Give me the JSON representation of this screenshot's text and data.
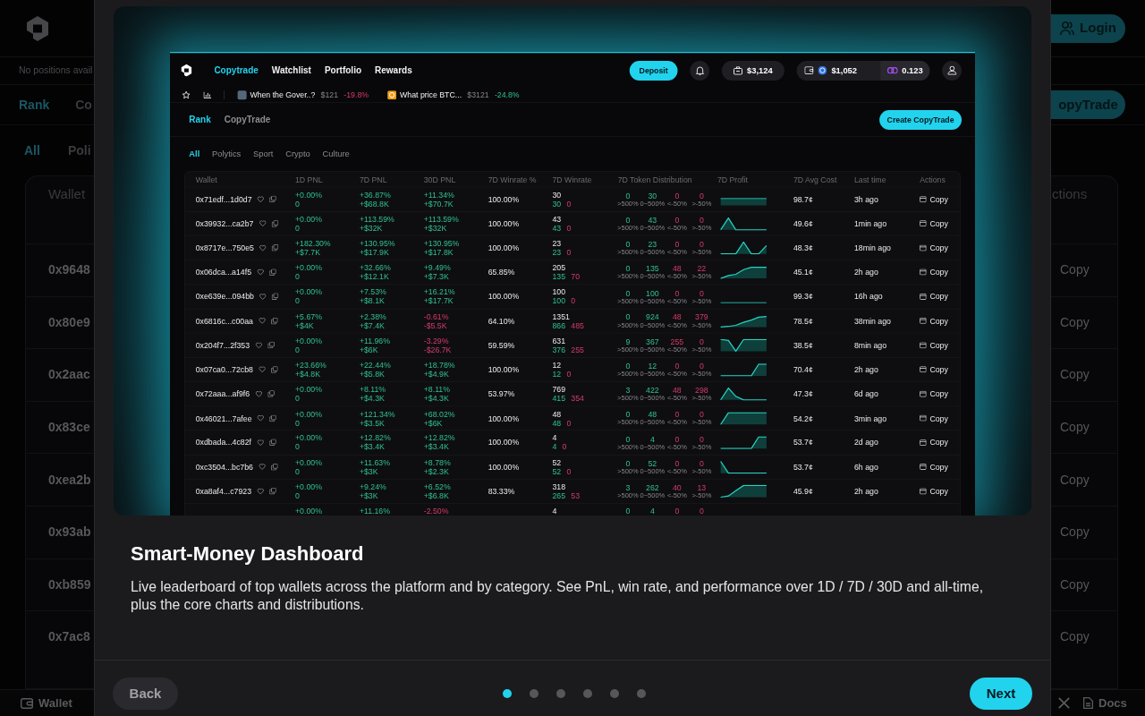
{
  "background_page": {
    "login_button": "Login",
    "notice": "No positions avail",
    "tabs": [
      {
        "label": "Rank",
        "selected": true
      },
      {
        "label": "Co",
        "selected": false
      }
    ],
    "create_button": "opyTrade",
    "filters": [
      {
        "label": "All",
        "selected": true
      },
      {
        "label": "Poli",
        "selected": false
      }
    ],
    "table": {
      "columns": [
        "Wallet",
        "ctions"
      ],
      "rows": [
        {
          "wallet": "0x9648",
          "action": "Copy"
        },
        {
          "wallet": "0x80e9",
          "action": "Copy"
        },
        {
          "wallet": "0x2aac",
          "action": "Copy"
        },
        {
          "wallet": "0x83ce",
          "action": "Copy"
        },
        {
          "wallet": "0xea2b",
          "action": "Copy"
        },
        {
          "wallet": "0x93ab",
          "action": "Copy"
        },
        {
          "wallet": "0xb859",
          "action": "Copy"
        },
        {
          "wallet": "0x7ac8",
          "action": "Copy"
        }
      ]
    },
    "footer": {
      "wallet_link": "Wallet",
      "docs_link": "Docs"
    }
  },
  "modal": {
    "screenshot": {
      "nav": {
        "links": [
          {
            "label": "Copytrade",
            "selected": true
          },
          {
            "label": "Watchlist",
            "selected": false
          },
          {
            "label": "Portfolio",
            "selected": false
          },
          {
            "label": "Rewards",
            "selected": false
          }
        ],
        "deposit_button": "Deposit",
        "portfolio_value": "$3,124",
        "wallet_balance": "$1,052",
        "token_balance": "0.123"
      },
      "ticker": [
        {
          "kind": "photo",
          "title": "When the Gover..?",
          "price": "$121",
          "change": "-19.8%",
          "loss": true
        },
        {
          "kind": "coin",
          "title": "What price BTC...",
          "price": "$3121",
          "change": "-24.8%",
          "loss": false
        }
      ],
      "tabs": [
        {
          "label": "Rank",
          "selected": true
        },
        {
          "label": "CopyTrade",
          "selected": false
        }
      ],
      "create_button": "Create CopyTrade",
      "filters": [
        {
          "label": "All",
          "selected": true
        },
        {
          "label": "Polytics",
          "selected": false
        },
        {
          "label": "Sport",
          "selected": false
        },
        {
          "label": "Crypto",
          "selected": false
        },
        {
          "label": "Culture",
          "selected": false
        }
      ],
      "table": {
        "columns": [
          "Wallet",
          "1D PNL",
          "7D PNL",
          "30D PNL",
          "7D Winrate %",
          "7D Winrate",
          "7D Token Distribution",
          "7D Profit",
          "7D Avg Cost",
          "Last time",
          "Actions"
        ],
        "rows": [
          {
            "kind": "full",
            "wallet": "0x71edf...1d0d7",
            "pnl_1d": {
              "percent": "+0.00%",
              "amount": "0",
              "loss": false
            },
            "pnl_7d": {
              "percent": "+36.87%",
              "amount": "+$68.8K",
              "loss": false
            },
            "pnl_30d": {
              "percent": "+11.34%",
              "amount": "+$70.7K",
              "loss": false
            },
            "winrate_pct": "100.00%",
            "winrate": {
              "total": "30",
              "wins": "30",
              "losses": "0"
            },
            "distribution": [
              {
                "value": "0",
                "label": ">500%",
                "loss": false
              },
              {
                "value": "30",
                "label": "0~500%",
                "loss": false
              },
              {
                "value": "0",
                "label": "<-50%",
                "loss": true
              },
              {
                "value": "0",
                "label": ">-50%",
                "loss": true
              }
            ],
            "avg_cost": "98.7¢",
            "last_time": "3h ago",
            "action": "Copy"
          },
          {
            "kind": "full",
            "wallet": "0x39932...ca2b7",
            "pnl_1d": {
              "percent": "+0.00%",
              "amount": "0",
              "loss": false
            },
            "pnl_7d": {
              "percent": "+113.59%",
              "amount": "+$32K",
              "loss": false
            },
            "pnl_30d": {
              "percent": "+113.59%",
              "amount": "+$32K",
              "loss": false
            },
            "winrate_pct": "100.00%",
            "winrate": {
              "total": "43",
              "wins": "43",
              "losses": "0"
            },
            "distribution": [
              {
                "value": "0",
                "label": ">500%",
                "loss": false
              },
              {
                "value": "43",
                "label": "0~500%",
                "loss": false
              },
              {
                "value": "0",
                "label": "<-50%",
                "loss": true
              },
              {
                "value": "0",
                "label": ">-50%",
                "loss": true
              }
            ],
            "avg_cost": "49.6¢",
            "last_time": "1min ago",
            "action": "Copy"
          },
          {
            "kind": "full",
            "wallet": "0x8717e...750e5",
            "pnl_1d": {
              "percent": "+182.30%",
              "amount": "+$7.7K",
              "loss": false
            },
            "pnl_7d": {
              "percent": "+130.95%",
              "amount": "+$17.9K",
              "loss": false
            },
            "pnl_30d": {
              "percent": "+130.95%",
              "amount": "+$17.8K",
              "loss": false
            },
            "winrate_pct": "100.00%",
            "winrate": {
              "total": "23",
              "wins": "23",
              "losses": "0"
            },
            "distribution": [
              {
                "value": "0",
                "label": ">500%",
                "loss": false
              },
              {
                "value": "23",
                "label": "0~500%",
                "loss": false
              },
              {
                "value": "0",
                "label": "<-50%",
                "loss": true
              },
              {
                "value": "0",
                "label": ">-50%",
                "loss": true
              }
            ],
            "avg_cost": "48.3¢",
            "last_time": "18min ago",
            "action": "Copy"
          },
          {
            "kind": "full",
            "wallet": "0x06dca...a14f5",
            "pnl_1d": {
              "percent": "+0.00%",
              "amount": "0",
              "loss": false
            },
            "pnl_7d": {
              "percent": "+32.66%",
              "amount": "+$12.1K",
              "loss": false
            },
            "pnl_30d": {
              "percent": "+9.49%",
              "amount": "+$7.3K",
              "loss": false
            },
            "winrate_pct": "65.85%",
            "winrate": {
              "total": "205",
              "wins": "135",
              "losses": "70"
            },
            "distribution": [
              {
                "value": "0",
                "label": ">500%",
                "loss": false
              },
              {
                "value": "135",
                "label": "0~500%",
                "loss": false
              },
              {
                "value": "48",
                "label": "<-50%",
                "loss": true
              },
              {
                "value": "22",
                "label": ">-50%",
                "loss": true
              }
            ],
            "avg_cost": "45.1¢",
            "last_time": "2h ago",
            "action": "Copy"
          },
          {
            "kind": "full",
            "wallet": "0xe639e...094bb",
            "pnl_1d": {
              "percent": "+0.00%",
              "amount": "0",
              "loss": false
            },
            "pnl_7d": {
              "percent": "+7.53%",
              "amount": "+$8.1K",
              "loss": false
            },
            "pnl_30d": {
              "percent": "+16.21%",
              "amount": "+$17.7K",
              "loss": false
            },
            "winrate_pct": "100.00%",
            "winrate": {
              "total": "100",
              "wins": "100",
              "losses": "0"
            },
            "distribution": [
              {
                "value": "0",
                "label": ">500%",
                "loss": false
              },
              {
                "value": "100",
                "label": "0~500%",
                "loss": false
              },
              {
                "value": "0",
                "label": "<-50%",
                "loss": true
              },
              {
                "value": "0",
                "label": ">-50%",
                "loss": true
              }
            ],
            "avg_cost": "99.3¢",
            "last_time": "16h ago",
            "action": "Copy"
          },
          {
            "kind": "full",
            "wallet": "0x6816c...c00aa",
            "pnl_1d": {
              "percent": "+5.67%",
              "amount": "+$4K",
              "loss": false
            },
            "pnl_7d": {
              "percent": "+2.38%",
              "amount": "+$7.4K",
              "loss": false
            },
            "pnl_30d": {
              "percent": "-0.61%",
              "amount": "-$5.5K",
              "loss": true
            },
            "winrate_pct": "64.10%",
            "winrate": {
              "total": "1351",
              "wins": "866",
              "losses": "485"
            },
            "distribution": [
              {
                "value": "0",
                "label": ">500%",
                "loss": false
              },
              {
                "value": "924",
                "label": "0~500%",
                "loss": false
              },
              {
                "value": "48",
                "label": "<-50%",
                "loss": true
              },
              {
                "value": "379",
                "label": ">-50%",
                "loss": true
              }
            ],
            "avg_cost": "78.5¢",
            "last_time": "38min ago",
            "action": "Copy"
          },
          {
            "kind": "full",
            "wallet": "0x204f7...2f353",
            "pnl_1d": {
              "percent": "+0.00%",
              "amount": "0",
              "loss": false
            },
            "pnl_7d": {
              "percent": "+11.96%",
              "amount": "+$6K",
              "loss": false
            },
            "pnl_30d": {
              "percent": "-3.29%",
              "amount": "-$26.7K",
              "loss": true
            },
            "winrate_pct": "59.59%",
            "winrate": {
              "total": "631",
              "wins": "376",
              "losses": "255"
            },
            "distribution": [
              {
                "value": "9",
                "label": ">500%",
                "loss": false
              },
              {
                "value": "367",
                "label": "0~500%",
                "loss": false
              },
              {
                "value": "255",
                "label": "<-50%",
                "loss": true
              },
              {
                "value": "0",
                "label": ">-50%",
                "loss": true
              }
            ],
            "avg_cost": "38.5¢",
            "last_time": "8min ago",
            "action": "Copy"
          },
          {
            "kind": "full",
            "wallet": "0x07ca0...72cb8",
            "pnl_1d": {
              "percent": "+23.66%",
              "amount": "+$4.8K",
              "loss": false
            },
            "pnl_7d": {
              "percent": "+22.44%",
              "amount": "+$5.8K",
              "loss": false
            },
            "pnl_30d": {
              "percent": "+18.78%",
              "amount": "+$4.9K",
              "loss": false
            },
            "winrate_pct": "100.00%",
            "winrate": {
              "total": "12",
              "wins": "12",
              "losses": "0"
            },
            "distribution": [
              {
                "value": "0",
                "label": ">500%",
                "loss": false
              },
              {
                "value": "12",
                "label": "0~500%",
                "loss": false
              },
              {
                "value": "0",
                "label": "<-50%",
                "loss": true
              },
              {
                "value": "0",
                "label": ">-50%",
                "loss": true
              }
            ],
            "avg_cost": "70.4¢",
            "last_time": "2h ago",
            "action": "Copy"
          },
          {
            "kind": "full",
            "wallet": "0x72aaa...af9f6",
            "pnl_1d": {
              "percent": "+0.00%",
              "amount": "0",
              "loss": false
            },
            "pnl_7d": {
              "percent": "+8.11%",
              "amount": "+$4.3K",
              "loss": false
            },
            "pnl_30d": {
              "percent": "+8.11%",
              "amount": "+$4.3K",
              "loss": false
            },
            "winrate_pct": "53.97%",
            "winrate": {
              "total": "769",
              "wins": "415",
              "losses": "354"
            },
            "distribution": [
              {
                "value": "3",
                "label": ">500%",
                "loss": false
              },
              {
                "value": "422",
                "label": "0~500%",
                "loss": false
              },
              {
                "value": "48",
                "label": "<-50%",
                "loss": true
              },
              {
                "value": "298",
                "label": ">-50%",
                "loss": true
              }
            ],
            "avg_cost": "47.3¢",
            "last_time": "6d ago",
            "action": "Copy"
          },
          {
            "kind": "full",
            "wallet": "0x46021...7afee",
            "pnl_1d": {
              "percent": "+0.00%",
              "amount": "0",
              "loss": false
            },
            "pnl_7d": {
              "percent": "+121.34%",
              "amount": "+$3.5K",
              "loss": false
            },
            "pnl_30d": {
              "percent": "+68.02%",
              "amount": "+$6K",
              "loss": false
            },
            "winrate_pct": "100.00%",
            "winrate": {
              "total": "48",
              "wins": "48",
              "losses": "0"
            },
            "distribution": [
              {
                "value": "0",
                "label": ">500%",
                "loss": false
              },
              {
                "value": "48",
                "label": "0~500%",
                "loss": false
              },
              {
                "value": "0",
                "label": "<-50%",
                "loss": true
              },
              {
                "value": "0",
                "label": ">-50%",
                "loss": true
              }
            ],
            "avg_cost": "54.2¢",
            "last_time": "3min ago",
            "action": "Copy"
          },
          {
            "kind": "full",
            "wallet": "0xdbada...4c82f",
            "pnl_1d": {
              "percent": "+0.00%",
              "amount": "0",
              "loss": false
            },
            "pnl_7d": {
              "percent": "+12.82%",
              "amount": "+$3.4K",
              "loss": false
            },
            "pnl_30d": {
              "percent": "+12.82%",
              "amount": "+$3.4K",
              "loss": false
            },
            "winrate_pct": "100.00%",
            "winrate": {
              "total": "4",
              "wins": "4",
              "losses": "0"
            },
            "distribution": [
              {
                "value": "0",
                "label": ">500%",
                "loss": false
              },
              {
                "value": "4",
                "label": "0~500%",
                "loss": false
              },
              {
                "value": "0",
                "label": "<-50%",
                "loss": true
              },
              {
                "value": "0",
                "label": ">-50%",
                "loss": true
              }
            ],
            "avg_cost": "53.7¢",
            "last_time": "2d ago",
            "action": "Copy"
          },
          {
            "kind": "full",
            "wallet": "0xc3504...bc7b6",
            "pnl_1d": {
              "percent": "+0.00%",
              "amount": "0",
              "loss": false
            },
            "pnl_7d": {
              "percent": "+11.63%",
              "amount": "+$3K",
              "loss": false
            },
            "pnl_30d": {
              "percent": "+8.78%",
              "amount": "+$2.3K",
              "loss": false
            },
            "winrate_pct": "100.00%",
            "winrate": {
              "total": "52",
              "wins": "52",
              "losses": "0"
            },
            "distribution": [
              {
                "value": "0",
                "label": ">500%",
                "loss": false
              },
              {
                "value": "52",
                "label": "0~500%",
                "loss": false
              },
              {
                "value": "0",
                "label": "<-50%",
                "loss": true
              },
              {
                "value": "0",
                "label": ">-50%",
                "loss": true
              }
            ],
            "avg_cost": "53.7¢",
            "last_time": "6h ago",
            "action": "Copy"
          },
          {
            "kind": "full",
            "wallet": "0xa8af4...c7923",
            "pnl_1d": {
              "percent": "+0.00%",
              "amount": "0",
              "loss": false
            },
            "pnl_7d": {
              "percent": "+9.24%",
              "amount": "+$3K",
              "loss": false
            },
            "pnl_30d": {
              "percent": "+6.52%",
              "amount": "+$6.8K",
              "loss": false
            },
            "winrate_pct": "83.33%",
            "winrate": {
              "total": "318",
              "wins": "265",
              "losses": "53"
            },
            "distribution": [
              {
                "value": "3",
                "label": ">500%",
                "loss": false
              },
              {
                "value": "262",
                "label": "0~500%",
                "loss": false
              },
              {
                "value": "40",
                "label": "<-50%",
                "loss": true
              },
              {
                "value": "13",
                "label": ">-50%",
                "loss": true
              }
            ],
            "avg_cost": "45.9¢",
            "last_time": "2h ago",
            "action": "Copy"
          },
          {
            "kind": "cut",
            "pnl_1d": {
              "percent": "+0.00%",
              "loss": false
            },
            "pnl_7d": {
              "percent": "+11.16%",
              "loss": false
            },
            "pnl_30d": {
              "percent": "-2.50%",
              "loss": true
            },
            "winrate": {
              "total": "4"
            },
            "distribution": [
              {
                "value": "0",
                "loss": false
              },
              {
                "value": "4",
                "loss": false
              },
              {
                "value": "0",
                "loss": true
              },
              {
                "value": "0",
                "loss": true
              }
            ]
          }
        ]
      }
    },
    "title": "Smart-Money Dashboard",
    "description": "Live leaderboard of top wallets across the platform and by category. See PnL, win rate, and performance over 1D / 7D / 30D and all-time, plus the core charts and distributions.",
    "back_button": "Back",
    "steps": [
      {
        "selected": true
      },
      {
        "selected": false
      },
      {
        "selected": false
      },
      {
        "selected": false
      },
      {
        "selected": false
      },
      {
        "selected": false
      }
    ],
    "next_button": "Next"
  }
}
